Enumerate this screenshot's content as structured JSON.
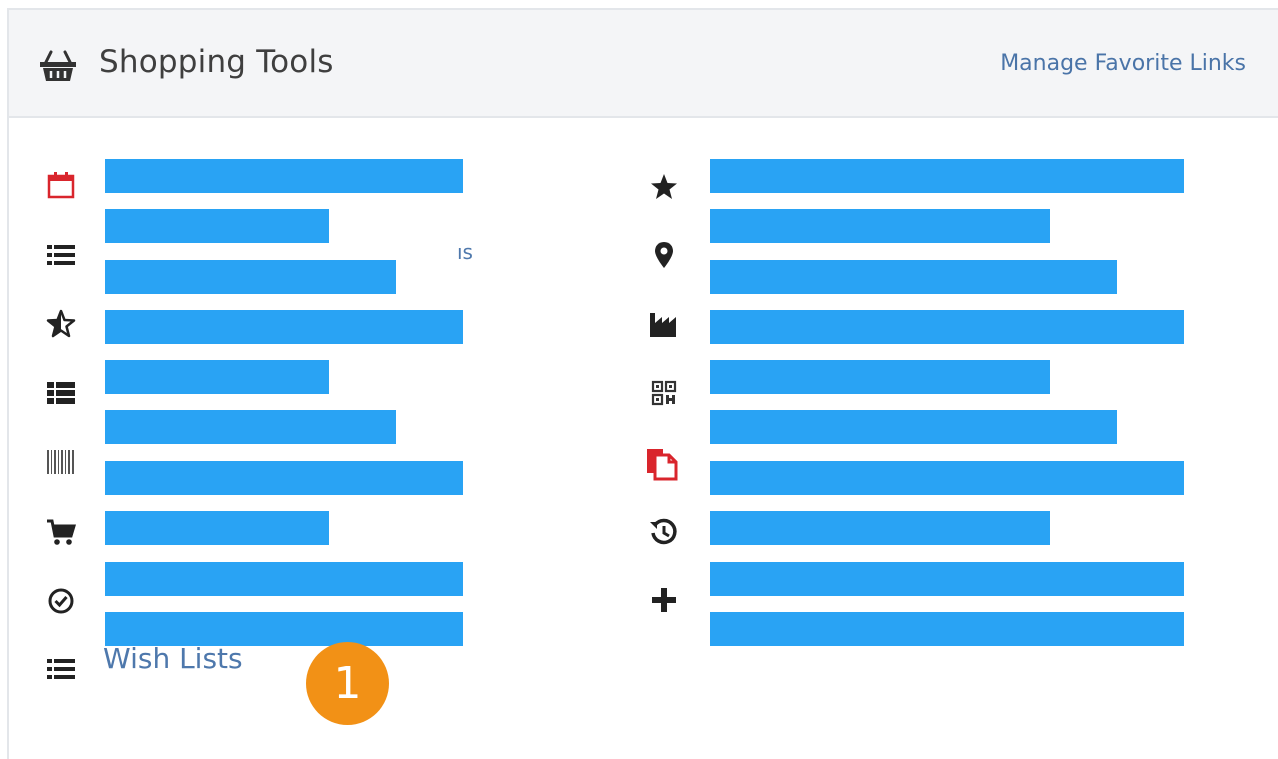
{
  "header": {
    "title": "Shopping Tools",
    "manage_link": "Manage Favorite Links",
    "icon": "basket-icon"
  },
  "left_column": {
    "icons": [
      "calendar-icon",
      "list-icon",
      "star-half-icon",
      "list-bold-icon",
      "barcode-icon",
      "cart-icon",
      "check-circle-icon",
      "list-icon"
    ],
    "peek_text": "ıs",
    "last_item_label": "Wish Lists"
  },
  "right_column": {
    "icons": [
      "star-icon",
      "map-marker-icon",
      "factory-icon",
      "qr-code-icon",
      "documents-icon",
      "history-icon",
      "plus-icon"
    ]
  },
  "callout_badge": "1",
  "colors": {
    "redaction_bar": "#29a3f4",
    "link": "#4e78ac",
    "badge": "#f29116",
    "accent_red": "#d9252c"
  }
}
